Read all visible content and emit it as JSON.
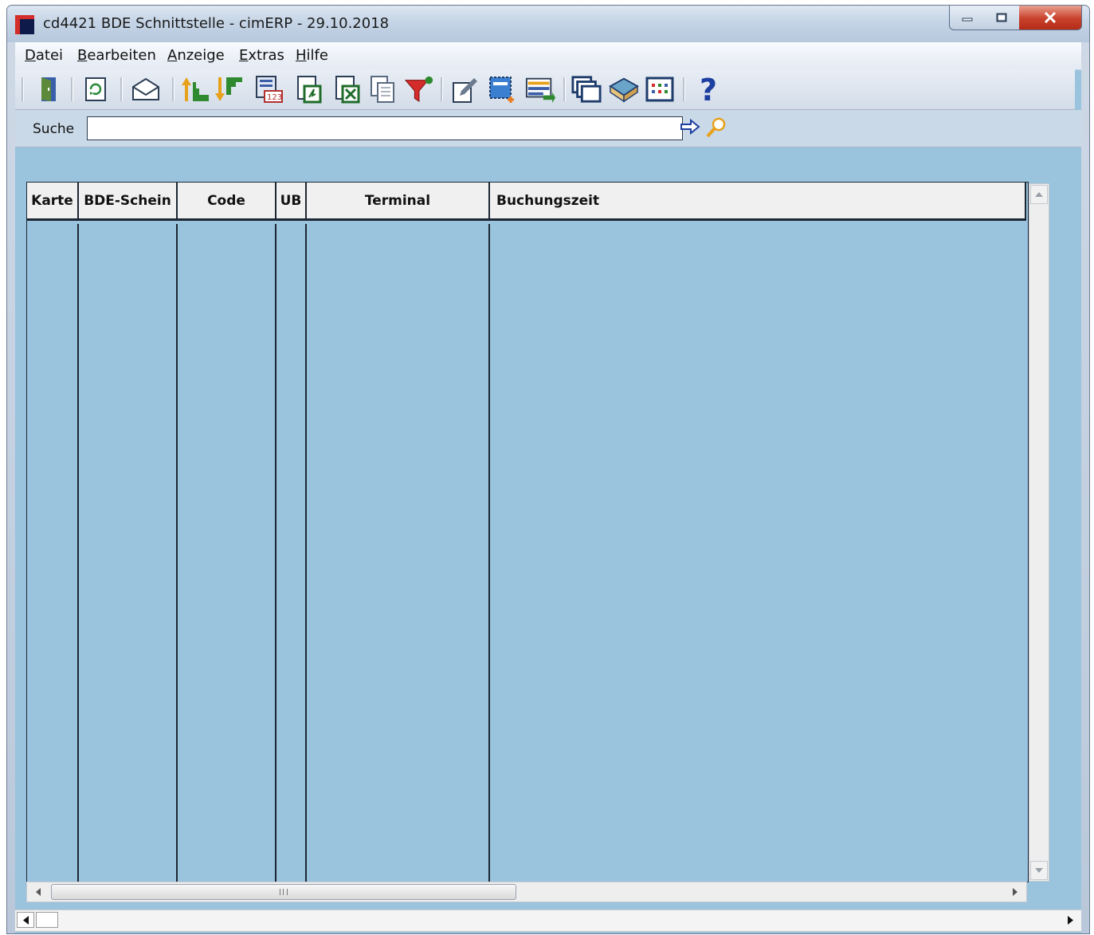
{
  "window": {
    "title": "cd4421 BDE Schnittstelle - cimERP - 29.10.2018"
  },
  "menu": {
    "items": [
      {
        "label": "Datei"
      },
      {
        "label": "Bearbeiten"
      },
      {
        "label": "Anzeige"
      },
      {
        "label": "Extras"
      },
      {
        "label": "Hilfe"
      }
    ]
  },
  "toolbar": {
    "icons": [
      "exit-icon",
      "refresh-icon",
      "mail-icon",
      "sort-ascending-icon",
      "sort-descending-icon",
      "number-format-icon",
      "export-document-icon",
      "export-excel-icon",
      "copy-icon",
      "filter-icon",
      "edit-icon",
      "new-record-icon",
      "insert-list-icon",
      "windows-icon",
      "book-icon",
      "grid-view-icon",
      "help-icon"
    ]
  },
  "search": {
    "label": "Suche",
    "value": ""
  },
  "table": {
    "columns": [
      {
        "label": "Karte"
      },
      {
        "label": "BDE-Schein"
      },
      {
        "label": "Code"
      },
      {
        "label": "UB"
      },
      {
        "label": "Terminal"
      },
      {
        "label": "Buchungszeit"
      }
    ],
    "rows": []
  },
  "colors": {
    "grid_background": "#9ac3de",
    "header_background": "#f0f0f0",
    "close_button": "#c8412c"
  }
}
